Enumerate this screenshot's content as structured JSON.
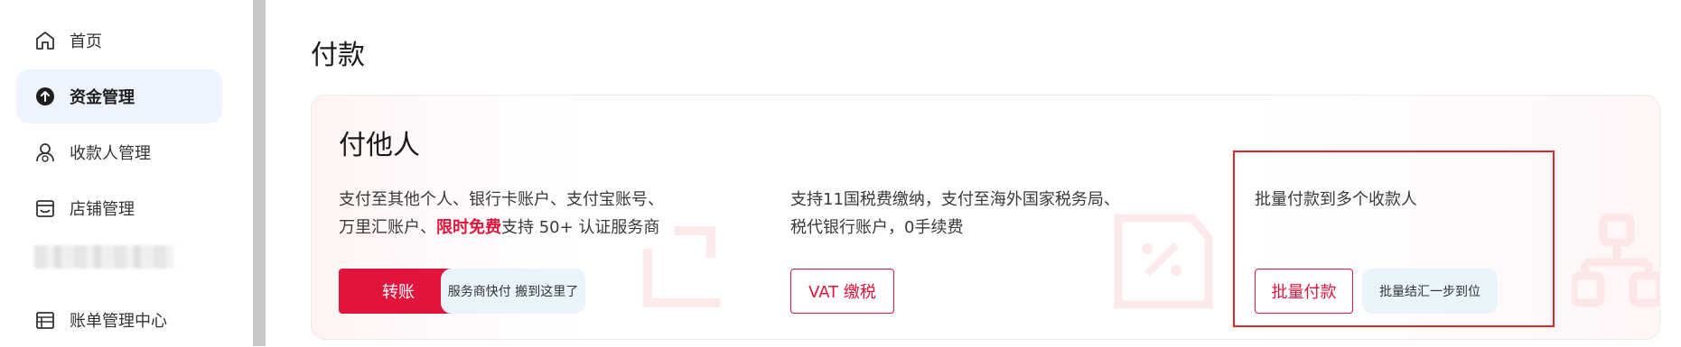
{
  "sidebar": {
    "items": [
      {
        "label": "首页",
        "icon": "home-icon",
        "active": false
      },
      {
        "label": "资金管理",
        "icon": "arrow-up-circle-icon",
        "active": true
      },
      {
        "label": "收款人管理",
        "icon": "payee-person-icon",
        "active": false
      },
      {
        "label": "店铺管理",
        "icon": "store-icon",
        "active": false
      },
      {
        "label": "账单管理中心",
        "icon": "bill-list-icon",
        "active": false
      }
    ]
  },
  "main": {
    "page_title": "付款",
    "card": {
      "title": "付他人",
      "sections": {
        "transfer": {
          "desc_line1": "支付至其他个人、银行卡账户、支付宝账号、",
          "desc_line2_prefix": "万里汇账户、",
          "desc_line2_highlight": "限时免费",
          "desc_line2_suffix": "支持 50+ 认证服务商",
          "button_label": "转账",
          "tag_label": "服务商快付 搬到这里了"
        },
        "vat": {
          "desc_line1": "支持11国税费缴纳，支付至海外国家税务局、",
          "desc_line2": "税代银行账户，0手续费",
          "button_label": "VAT 缴税"
        },
        "batch": {
          "desc_line1": "批量付款到多个收款人",
          "button_label": "批量付款",
          "tag_label": "批量结汇一步到位"
        }
      }
    }
  },
  "colors": {
    "accent": "#e0143c",
    "active_nav_bg": "#eef4fe",
    "tag_bg": "#eaf4fb",
    "highlight_border": "#e0262b"
  }
}
